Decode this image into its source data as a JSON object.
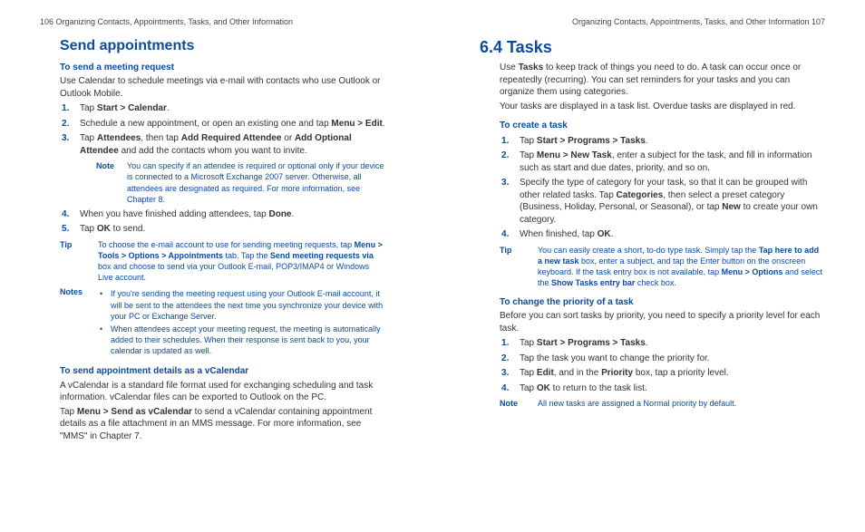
{
  "left_page": {
    "running_head": "106  Organizing Contacts, Appointments, Tasks, and Other Information",
    "h1": "Send appointments",
    "h2a": "To send a meeting request",
    "intro_a": "Use Calendar to schedule meetings via e-mail with contacts who use Outlook or Outlook Mobile.",
    "steps_a": {
      "s1_pre": "Tap ",
      "s1_b": "Start > Calendar",
      "s1_post": ".",
      "s2_pre": "Schedule a new appointment, or open an existing one and tap ",
      "s2_b": "Menu > Edit",
      "s2_post": ".",
      "s3_pre": "Tap ",
      "s3_b1": "Attendees",
      "s3_mid": ", then tap ",
      "s3_b2": "Add Required Attendee",
      "s3_or": " or ",
      "s3_b3": "Add Optional Attendee",
      "s3_post": " and add the contacts whom you want to invite.",
      "s4_pre": "When you have finished adding attendees, tap ",
      "s4_b": "Done",
      "s4_post": ".",
      "s5_pre": "Tap ",
      "s5_b": "OK",
      "s5_post": " to send."
    },
    "inner_note_label": "Note",
    "inner_note_text": "You can specify if an attendee is required or optional only if your device is connected to a Microsoft Exchange 2007 server. Otherwise, all attendees are designated as required. For more information, see Chapter 8.",
    "tip_label": "Tip",
    "tip_text_pre": "To choose the e-mail account to use for sending meeting requests, tap ",
    "tip_b1": "Menu > Tools > Options > Appointments",
    "tip_text_mid": " tab. Tap the ",
    "tip_b2": "Send meeting requests via",
    "tip_text_post": " box and choose to send via your Outlook E-mail, POP3/IMAP4 or Windows Live account.",
    "notes_label": "Notes",
    "notes_items": [
      "If you're sending the meeting request using your Outlook E-mail account, it will be sent to the attendees the next time you synchronize your device with your PC or Exchange Server.",
      "When attendees accept your meeting request, the meeting is automatically added to their schedules. When their response is sent back to you, your calendar is updated as well."
    ],
    "h2b": "To send appointment details as a vCalendar",
    "para_b1": "A vCalendar is a standard file format used for exchanging scheduling and task information. vCalendar files can be exported to Outlook on the PC.",
    "para_b2_pre": "Tap ",
    "para_b2_b": "Menu > Send as vCalendar",
    "para_b2_post": " to send a vCalendar containing appointment details as a file attachment in an MMS message. For more information, see \"MMS\" in Chapter 7."
  },
  "right_page": {
    "running_head": "Organizing Contacts, Appointments, Tasks, and Other Information  107",
    "section_title": "6.4  Tasks",
    "intro1_pre": "Use ",
    "intro1_b": "Tasks",
    "intro1_post": " to keep track of things you need to do. A task can occur once or repeatedly (recurring). You can set reminders for your tasks and you can organize them using categories.",
    "intro2": "Your tasks are displayed in a task list. Overdue tasks are displayed in red.",
    "h2a": "To create a task",
    "steps_a": {
      "s1_pre": "Tap ",
      "s1_b": "Start > Programs > Tasks",
      "s1_post": ".",
      "s2_pre": "Tap ",
      "s2_b": "Menu > New Task",
      "s2_post": ", enter a subject for the task, and fill in information such as start and due dates, priority, and so on.",
      "s3_pre": "Specify the type of category for your task, so that it can be grouped with other related tasks. Tap ",
      "s3_b1": "Categories",
      "s3_mid": ", then select a preset category (Business, Holiday, Personal, or Seasonal), or tap ",
      "s3_b2": "New",
      "s3_post": " to create your own category.",
      "s4_pre": "When finished, tap ",
      "s4_b": "OK",
      "s4_post": "."
    },
    "tip_label": "Tip",
    "tip_pre": "You can easily create a short, to-do type task. Simply tap the ",
    "tip_b1": "Tap here to add a new task",
    "tip_mid1": " box, enter a subject, and tap the Enter button on the onscreen keyboard. If the task entry box is not available, tap ",
    "tip_b2": "Menu > Options",
    "tip_mid2": " and select the ",
    "tip_b3": "Show Tasks entry bar",
    "tip_post": " check box.",
    "h2b": "To change the priority of a task",
    "para_b": "Before you can sort tasks by priority, you need to specify a priority level for each task.",
    "steps_b": {
      "s1_pre": "Tap ",
      "s1_b": "Start > Programs > Tasks",
      "s1_post": ".",
      "s2": "Tap the task you want to change the priority for.",
      "s3_pre": "Tap ",
      "s3_b1": "Edit",
      "s3_mid": ", and in the ",
      "s3_b2": "Priority",
      "s3_post": " box, tap a priority level.",
      "s4_pre": "Tap ",
      "s4_b": "OK",
      "s4_post": " to return to the task list."
    },
    "note_label": "Note",
    "note_text": "All new tasks are assigned a Normal priority by default."
  }
}
